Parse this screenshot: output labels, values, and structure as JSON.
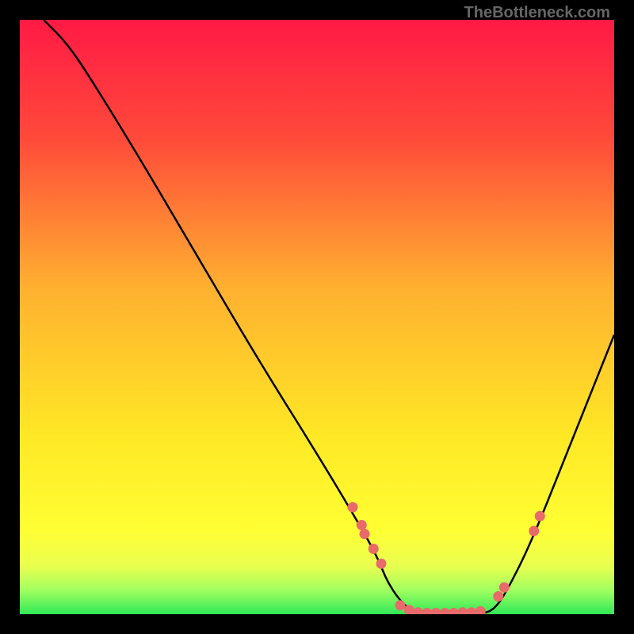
{
  "watermark": "TheBottleneck.com",
  "chart_data": {
    "type": "line",
    "title": "",
    "xlabel": "",
    "ylabel": "",
    "xlim": [
      0,
      100
    ],
    "ylim": [
      0,
      100
    ],
    "gradient_stops": [
      {
        "offset": 0,
        "color": "#ff1a45"
      },
      {
        "offset": 20,
        "color": "#ff4a3a"
      },
      {
        "offset": 45,
        "color": "#ffb030"
      },
      {
        "offset": 70,
        "color": "#ffe825"
      },
      {
        "offset": 86,
        "color": "#ffff34"
      },
      {
        "offset": 92,
        "color": "#e8ff50"
      },
      {
        "offset": 96,
        "color": "#a0ff60"
      },
      {
        "offset": 100,
        "color": "#30e858"
      }
    ],
    "curve": [
      {
        "x": 4,
        "y": 100
      },
      {
        "x": 8,
        "y": 96
      },
      {
        "x": 12,
        "y": 90
      },
      {
        "x": 20,
        "y": 77
      },
      {
        "x": 30,
        "y": 60
      },
      {
        "x": 40,
        "y": 43
      },
      {
        "x": 50,
        "y": 27
      },
      {
        "x": 56,
        "y": 17
      },
      {
        "x": 60,
        "y": 10
      },
      {
        "x": 62,
        "y": 5
      },
      {
        "x": 65,
        "y": 1
      },
      {
        "x": 68,
        "y": 0
      },
      {
        "x": 78,
        "y": 0
      },
      {
        "x": 80,
        "y": 1
      },
      {
        "x": 82,
        "y": 4
      },
      {
        "x": 86,
        "y": 12
      },
      {
        "x": 92,
        "y": 27
      },
      {
        "x": 98,
        "y": 42
      },
      {
        "x": 100,
        "y": 47
      }
    ],
    "points": [
      {
        "x": 56.0,
        "y": 18.0
      },
      {
        "x": 57.5,
        "y": 15.0
      },
      {
        "x": 58.0,
        "y": 13.5
      },
      {
        "x": 59.5,
        "y": 11.0
      },
      {
        "x": 60.8,
        "y": 8.5
      },
      {
        "x": 64.0,
        "y": 1.5
      },
      {
        "x": 65.5,
        "y": 0.7
      },
      {
        "x": 67.0,
        "y": 0.3
      },
      {
        "x": 68.5,
        "y": 0.2
      },
      {
        "x": 70.0,
        "y": 0.2
      },
      {
        "x": 71.5,
        "y": 0.2
      },
      {
        "x": 73.0,
        "y": 0.2
      },
      {
        "x": 74.5,
        "y": 0.3
      },
      {
        "x": 76.0,
        "y": 0.3
      },
      {
        "x": 77.5,
        "y": 0.5
      },
      {
        "x": 80.5,
        "y": 3.0
      },
      {
        "x": 81.5,
        "y": 4.5
      },
      {
        "x": 86.5,
        "y": 14.0
      },
      {
        "x": 87.5,
        "y": 16.5
      }
    ],
    "point_color": "#e86a6a",
    "curve_color": "#000000"
  }
}
